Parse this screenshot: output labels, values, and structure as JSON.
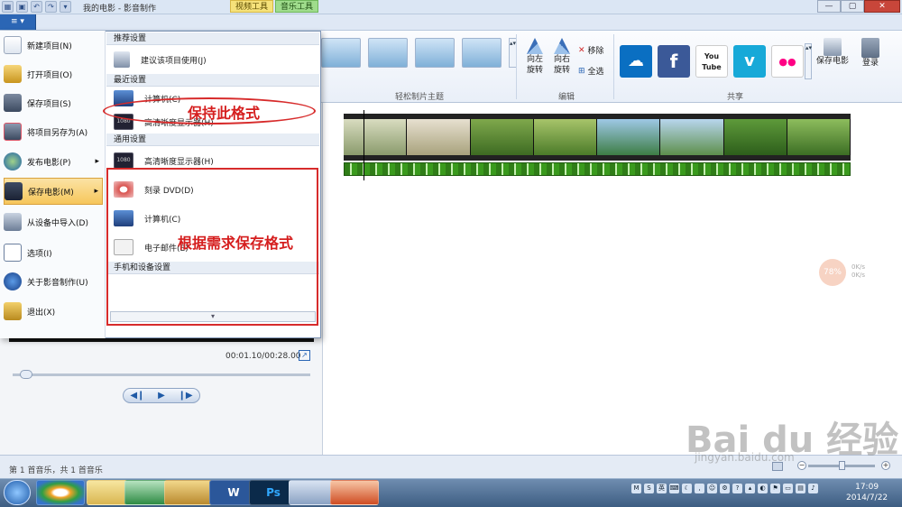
{
  "window": {
    "title": "我的电影 - 影音制作",
    "context_tabs": [
      "视频工具",
      "音乐工具"
    ]
  },
  "file_button": {
    "label": "≡ ▾"
  },
  "ribbon": {
    "groups": [
      {
        "label": "轻松制片主题"
      },
      {
        "label": "编辑",
        "buttons": [
          "向左旋转",
          "向右旋转",
          "移除",
          "全选"
        ]
      },
      {
        "label": "共享",
        "save_movie": "保存电影",
        "login": "登录",
        "share_targets": [
          {
            "icon": "skydrive-icon",
            "color": "#0a6fc2",
            "glyph": "☁"
          },
          {
            "icon": "facebook-icon",
            "color": "#3b5998",
            "glyph": "f"
          },
          {
            "icon": "youtube-icon",
            "color": "#e52d27",
            "glyph": "You Tube"
          },
          {
            "icon": "vimeo-icon",
            "color": "#17a9d8",
            "glyph": "v"
          },
          {
            "icon": "flickr-icon",
            "color": "#ffffff",
            "glyph": "●●"
          }
        ]
      }
    ]
  },
  "file_menu": {
    "items": [
      {
        "label": "新建项目(N)",
        "icon": "new-project-icon"
      },
      {
        "label": "打开项目(O)",
        "icon": "open-project-icon"
      },
      {
        "label": "保存项目(S)",
        "icon": "save-project-icon"
      },
      {
        "label": "将项目另存为(A)",
        "icon": "save-as-icon"
      },
      {
        "label": "发布电影(P)",
        "arrow": "▸",
        "icon": "publish-icon"
      },
      {
        "label": "保存电影(M)",
        "arrow": "▸",
        "icon": "save-movie-icon"
      },
      {
        "label": "从设备中导入(D)",
        "icon": "import-icon"
      },
      {
        "label": "选项(I)",
        "icon": "options-icon"
      },
      {
        "label": "关于影音制作(U)",
        "icon": "about-icon"
      },
      {
        "label": "退出(X)",
        "icon": "exit-icon"
      }
    ],
    "submenu": {
      "recommended_header": "推荐设置",
      "recommended": "建议该项目使用(J)",
      "recent_header": "最近设置",
      "recent": [
        "计算机(C)",
        "高清晰度显示器(H)"
      ],
      "common_header": "通用设置",
      "common": [
        "高清晰度显示器(H)",
        "刻录 DVD(D)",
        "计算机(C)",
        "电子邮件(E)"
      ],
      "phone_header": "手机和设备设置",
      "scroll_glyph": "▾"
    }
  },
  "annotations": {
    "keep_format": "保持此格式",
    "save_by_need": "根据需求保存格式"
  },
  "preview": {
    "time": "00:01.10/00:28.00",
    "controls": [
      "◀❙",
      "▶",
      "❙▶"
    ]
  },
  "storyboard": {
    "badge": "78%",
    "net_up": "0K/s",
    "net_down": "0K/s"
  },
  "status": {
    "text": "第 1 首音乐，共 1 首音乐"
  },
  "taskbar": {
    "apps": [
      "W",
      "Ps"
    ],
    "ime": "英",
    "clock_time": "17:09",
    "clock_date": "2014/7/22"
  },
  "watermark": {
    "main": "Bai du 经验",
    "sub": "jingyan.baidu.com"
  }
}
